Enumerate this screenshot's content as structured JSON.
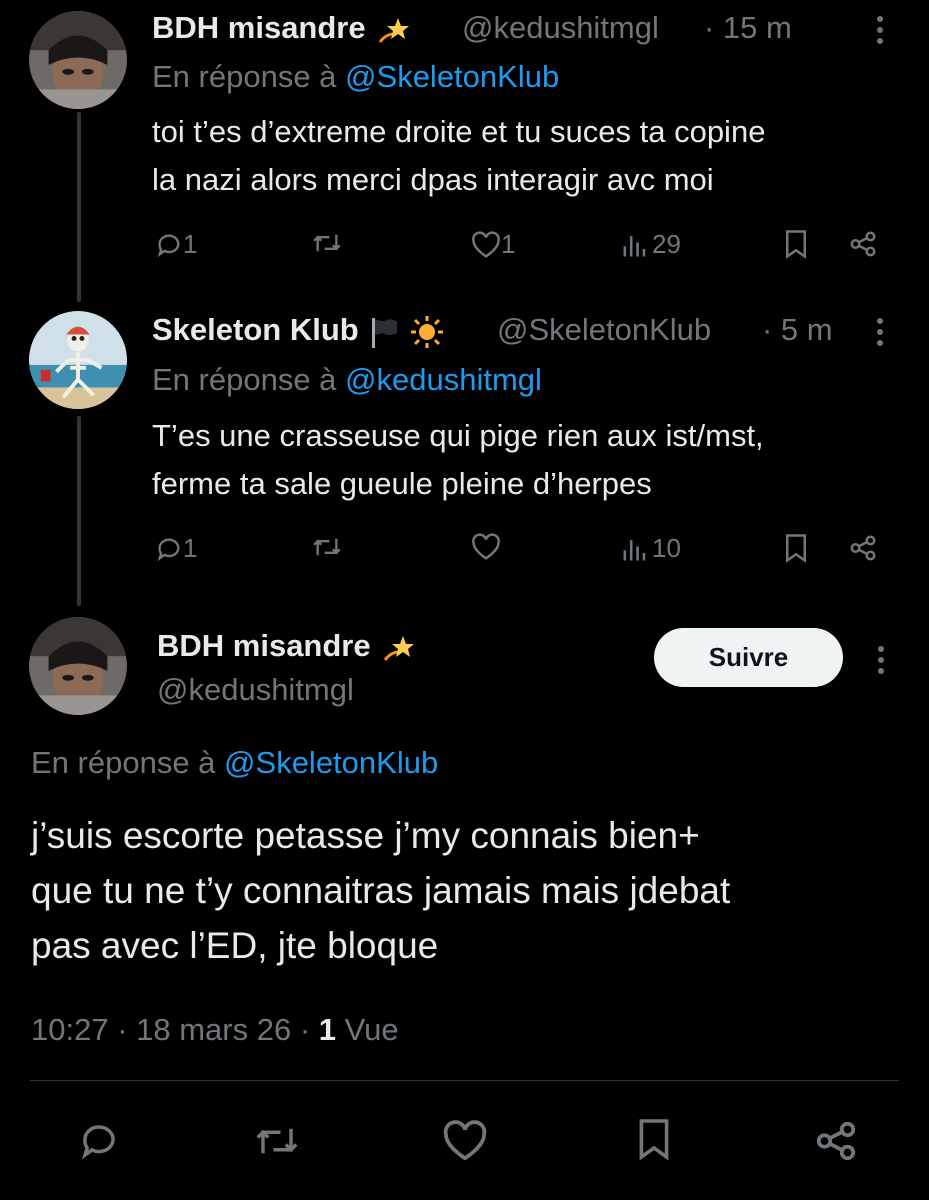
{
  "tweets": [
    {
      "name": "BDH misandre",
      "name_emoji": "dizzy",
      "handle": "@kedushitmgl",
      "time": "· 15 m",
      "reply_prefix": "En réponse à",
      "reply_handle": "@SkeletonKlub",
      "text_line1": "toi t’es d’extreme droite et tu suces ta copine",
      "text_line2": "la nazi alors merci dpas interagir avc moi",
      "replies": "1",
      "retweets": "",
      "likes": "1",
      "views": "29"
    },
    {
      "name": "Skeleton Klub",
      "name_emoji": "black-flag sun",
      "handle": "@SkeletonKlub",
      "time": "· 5 m",
      "reply_prefix": "En réponse à",
      "reply_handle": "@kedushitmgl",
      "text_line1": "T’es une crasseuse qui pige rien aux ist/mst,",
      "text_line2": "ferme ta sale gueule pleine d’herpes",
      "replies": "1",
      "retweets": "",
      "likes": "",
      "views": "10"
    }
  ],
  "main_tweet": {
    "name": "BDH misandre",
    "name_emoji": "dizzy",
    "handle": "@kedushitmgl",
    "follow_label": "Suivre",
    "reply_prefix": "En réponse à",
    "reply_handle": "@SkeletonKlub",
    "text_line1": "j’suis escorte petasse j’my connais bien+",
    "text_line2": "que tu ne t’y connaitras jamais mais jdebat",
    "text_line3": "pas avec l’ED, jte bloque",
    "time": "10:27",
    "date": "· 18 mars 26 ·",
    "view_count": "1",
    "view_label": "Vue"
  },
  "colors": {
    "background": "#000000",
    "text": "#e7e9ea",
    "secondary": "#71767b",
    "link": "#1d9bf0"
  }
}
